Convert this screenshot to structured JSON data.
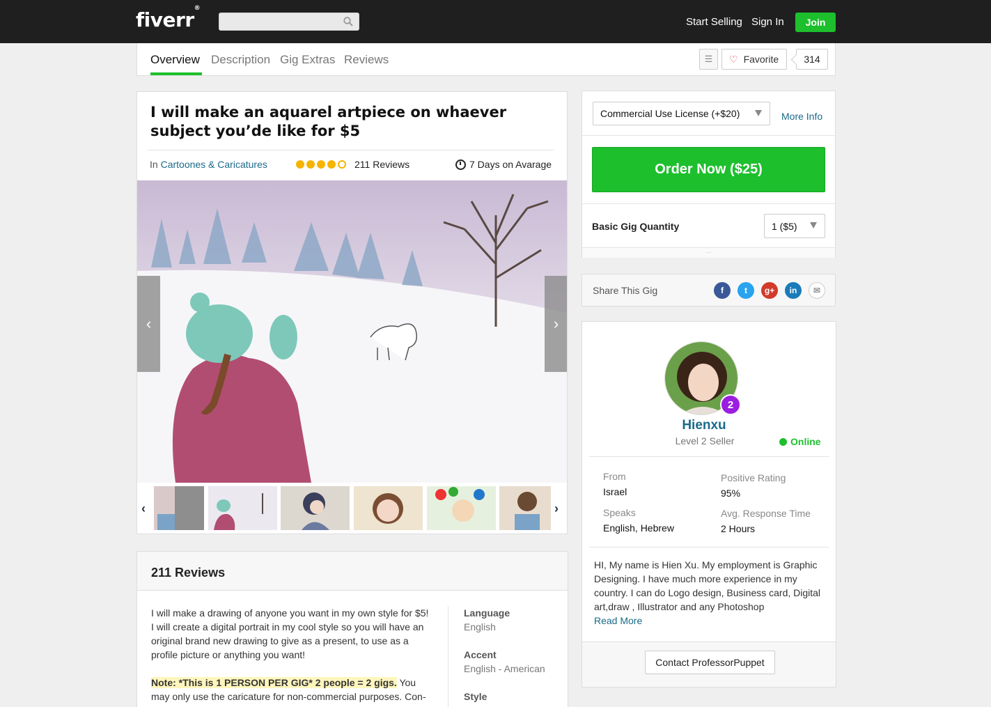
{
  "header": {
    "logo": "fiverr",
    "logo_mark": "®",
    "search_placeholder": "",
    "start_selling": "Start Selling",
    "sign_in": "Sign In",
    "join": "Join"
  },
  "subnav": {
    "tabs": [
      {
        "label": "Overview",
        "active": true
      },
      {
        "label": "Description",
        "active": false
      },
      {
        "label": "Gig Extras",
        "active": false
      },
      {
        "label": "Reviews",
        "active": false
      }
    ],
    "favorite_label": "Favorite",
    "favorite_count": "314"
  },
  "gig": {
    "title": "I will make an aquarel artpiece on whaever subject you’de like for $5",
    "category_prefix": "In",
    "category": "Cartoones & Caricatures",
    "rating_stars": 4,
    "rating_max": 5,
    "reviews_label": "211 Reviews",
    "delivery": "7 Days on Avarage"
  },
  "reviews_section": {
    "heading": "211 Reviews",
    "paragraph1": "I will make a drawing of anyone you want in my own style for $5! I will create a digital portrait in my cool style so you will have an original brand new drawing to give as a present, to use as a profile picture or anything you want!",
    "note": "Note: *This is 1 PERSON PER GIG*  2 people = 2 gigs.",
    "note_rest": "You may only use the caricature for non-commercial purposes. Con-",
    "attributes": [
      {
        "label": "Language",
        "value": "English"
      },
      {
        "label": "Accent",
        "value": "English - American"
      },
      {
        "label": "Style",
        "value": ""
      }
    ]
  },
  "order": {
    "license": "Commercial Use License (+$20)",
    "more_info": "More Info",
    "order_button": "Order Now ($25)",
    "quantity_label": "Basic Gig Quantity",
    "quantity": "1 ($5)",
    "footer_dots": "..."
  },
  "share": {
    "label": "Share This Gig",
    "icons": [
      "facebook-icon",
      "twitter-icon",
      "google-plus-icon",
      "linkedin-icon",
      "email-icon"
    ]
  },
  "seller": {
    "level_badge": "2",
    "name": "Hienxu",
    "level": "Level 2 Seller",
    "status": "Online",
    "from_label": "From",
    "from": "Israel",
    "rating_label": "Positive Rating",
    "rating": "95%",
    "speaks_label": "Speaks",
    "speaks": "English, Hebrew",
    "response_label": "Avg. Response Time",
    "response": "2 Hours",
    "bio": "HI, My name is Hien Xu. My employment is Graphic Designing. I have much more experience in my country. I can do Logo design, Business card, Digital art,draw , Illustrator and any Photoshop",
    "read_more": "Read More",
    "contact": "Contact ProfessorPuppet"
  },
  "colors": {
    "brand_green": "#1dbf2d",
    "link_blue": "#1a6a8a",
    "level_purple": "#9b1ee0",
    "star_gold": "#f5b400"
  }
}
